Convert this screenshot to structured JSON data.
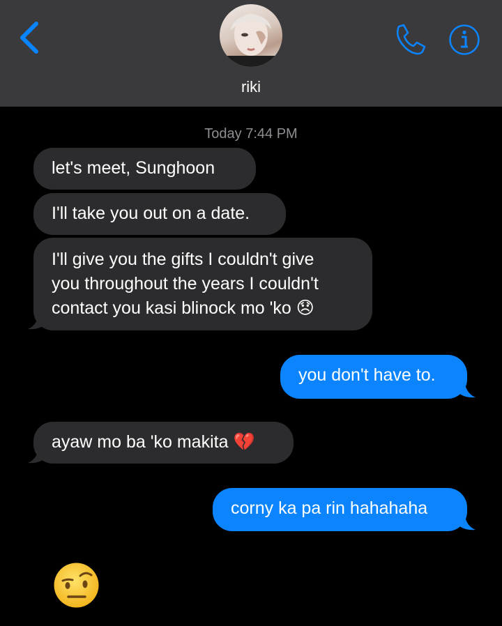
{
  "contact": {
    "name": "riki"
  },
  "timestamp": "Today 7:44 PM",
  "messages": [
    {
      "from": "them",
      "text": "let's meet, Sunghoon"
    },
    {
      "from": "them",
      "text": "I'll take you out on a date."
    },
    {
      "from": "them",
      "lines": [
        "I'll give you the gifts I couldn't give",
        "you throughout the years I couldn't",
        "contact you kasi blinock mo 'ko"
      ],
      "emoji": "😞"
    },
    {
      "from": "me",
      "text": "you don't have to."
    },
    {
      "from": "them",
      "text": "ayaw mo ba 'ko makita",
      "emoji": "💔"
    },
    {
      "from": "me",
      "text": "corny ka pa rin hahahaha"
    },
    {
      "from": "them",
      "emoji": "🤨"
    }
  ],
  "colors": {
    "header_bg": "#3a3a3c",
    "incoming_bubble": "#2c2c2e",
    "outgoing_bubble": "#0b84fe",
    "accent": "#0a84ff",
    "timestamp": "#8e8e93"
  },
  "icons": {
    "back": "chevron-left-icon",
    "call": "phone-icon",
    "details": "info-icon"
  }
}
